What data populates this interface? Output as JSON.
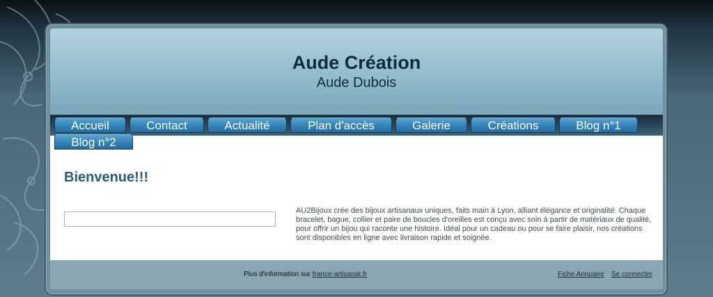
{
  "site": {
    "title": "Aude Création",
    "subtitle": "Aude Dubois"
  },
  "nav": {
    "items": [
      {
        "label": "Accueil"
      },
      {
        "label": "Contact"
      },
      {
        "label": "Actualité"
      },
      {
        "label": "Plan d'accès"
      },
      {
        "label": "Galerie"
      },
      {
        "label": "Créations"
      },
      {
        "label": "Blog n°1"
      },
      {
        "label": "Blog n°2"
      }
    ]
  },
  "main": {
    "heading": "Bienvenue!!!",
    "description": "AU2Bijoux crée des bijoux artisanaux uniques, faits main à Lyon, alliant élégance et originalité. Chaque bracelet, bague, collier et paire de boucles d'oreilles est conçu avec soin à partir de matériaux de qualité, pour offrir un bijou qui raconte une histoire. Idéal pour un cadeau ou pour se faire plaisir, nos créations sont disponibles en ligne avec livraison rapide et soignée."
  },
  "footer": {
    "info_prefix": "Plus d'information sur ",
    "info_link": "france-artisanat.fr",
    "annuaire_link": "Fiche Annuaire",
    "login_link": "Se connecter"
  },
  "colors": {
    "tab": "#3684b8",
    "heading": "#2b5c7c",
    "header_top": "#b2d2de",
    "footer_bg": "#8aa6b3"
  }
}
